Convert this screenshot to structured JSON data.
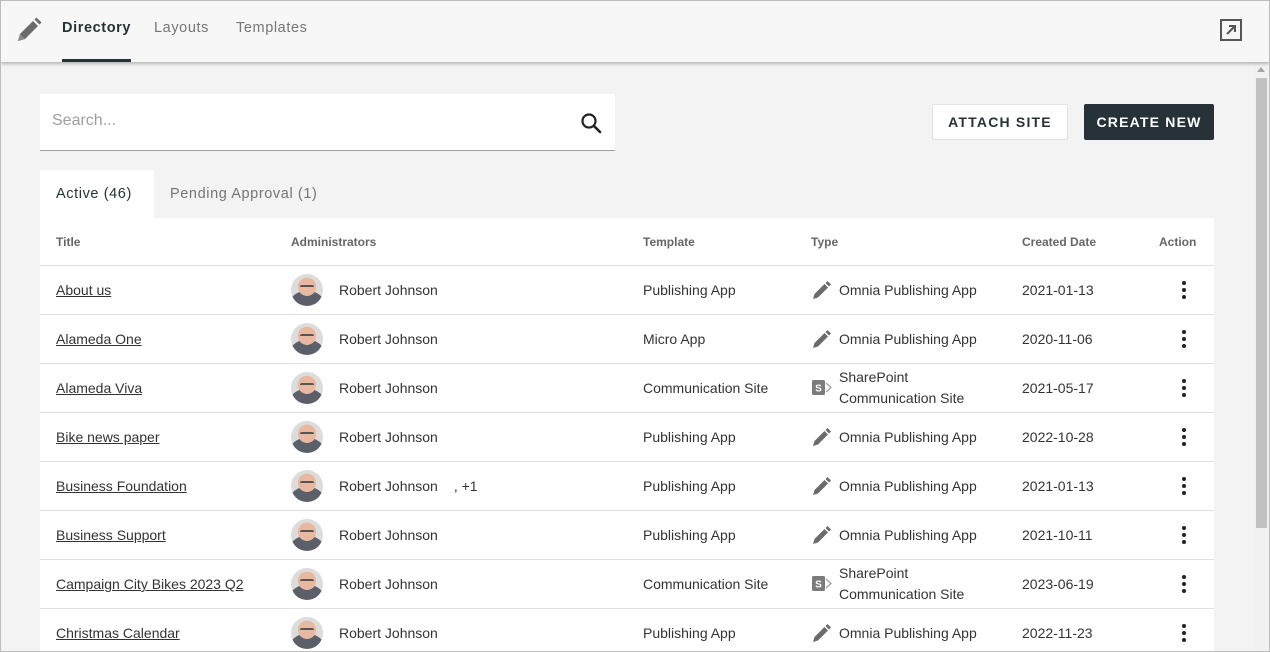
{
  "nav": {
    "tabs": [
      {
        "label": "Directory",
        "active": true
      },
      {
        "label": "Layouts",
        "active": false
      },
      {
        "label": "Templates",
        "active": false
      }
    ],
    "app_icon": "pencil-icon",
    "open_icon": "open-in-new-icon"
  },
  "search": {
    "placeholder": "Search...",
    "value": "",
    "icon": "search-icon"
  },
  "buttons": {
    "attach": "ATTACH SITE",
    "create": "CREATE NEW"
  },
  "list_tabs": [
    {
      "label": "Active (46)",
      "active": true
    },
    {
      "label": "Pending Approval (1)",
      "active": false
    }
  ],
  "table": {
    "columns": {
      "title": "Title",
      "administrators": "Administrators",
      "template": "Template",
      "type": "Type",
      "created": "Created Date",
      "action": "Action"
    },
    "rows": [
      {
        "title": "About us",
        "admin": "Robert Johnson",
        "extra": "",
        "template": "Publishing App",
        "type": "Omnia Publishing App",
        "type_icon": "omnia-pencil-icon",
        "date": "2021-01-13"
      },
      {
        "title": "Alameda One",
        "admin": "Robert Johnson",
        "extra": "",
        "template": "Micro App",
        "type": "Omnia Publishing App",
        "type_icon": "omnia-pencil-icon",
        "date": "2020-11-06"
      },
      {
        "title": "Alameda Viva",
        "admin": "Robert Johnson",
        "extra": "",
        "template": "Communication Site",
        "type": "SharePoint Communication Site",
        "type_line1": "SharePoint",
        "type_line2": "Communication Site",
        "type_icon": "sharepoint-icon",
        "date": "2021-05-17"
      },
      {
        "title": "Bike news paper",
        "admin": "Robert Johnson",
        "extra": "",
        "template": "Publishing App",
        "type": "Omnia Publishing App",
        "type_icon": "omnia-pencil-icon",
        "date": "2022-10-28"
      },
      {
        "title": "Business Foundation",
        "admin": "Robert Johnson",
        "extra": ", +1",
        "template": "Publishing App",
        "type": "Omnia Publishing App",
        "type_icon": "omnia-pencil-icon",
        "date": "2021-01-13"
      },
      {
        "title": "Business Support",
        "admin": "Robert Johnson",
        "extra": "",
        "template": "Publishing App",
        "type": "Omnia Publishing App",
        "type_icon": "omnia-pencil-icon",
        "date": "2021-10-11"
      },
      {
        "title": "Campaign City Bikes 2023 Q2",
        "admin": "Robert Johnson",
        "extra": "",
        "template": "Communication Site",
        "type": "SharePoint Communication Site",
        "type_line1": "SharePoint",
        "type_line2": "Communication Site",
        "type_icon": "sharepoint-icon",
        "date": "2023-06-19"
      },
      {
        "title": "Christmas Calendar",
        "admin": "Robert Johnson",
        "extra": "",
        "template": "Publishing App",
        "type": "Omnia Publishing App",
        "type_icon": "omnia-pencil-icon",
        "date": "2022-11-23"
      }
    ]
  },
  "colors": {
    "primary": "#263238",
    "background": "#f3f3f3",
    "surface": "#ffffff",
    "muted_text": "#757575"
  }
}
